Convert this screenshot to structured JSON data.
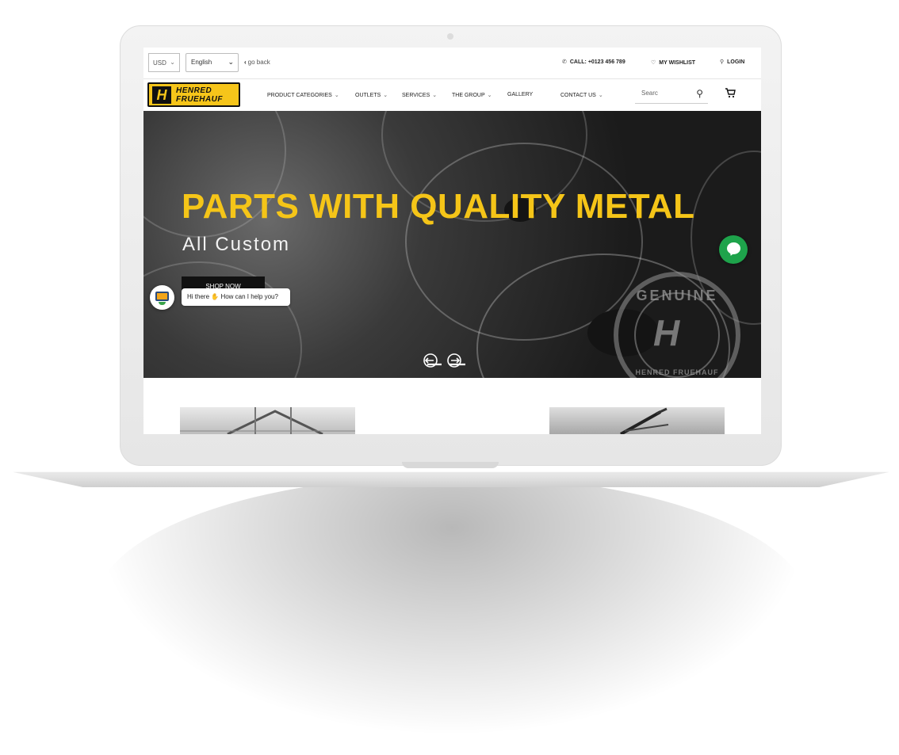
{
  "topbar": {
    "currency": "USD",
    "language": "English",
    "go_back": "go back",
    "call": "CALL: +0123 456 789",
    "wishlist": "MY WISHLIST",
    "login": "LOGIN"
  },
  "logo": {
    "line1": "HENRED",
    "line2": "FRUEHAUF"
  },
  "nav": {
    "items": [
      {
        "label": "PRODUCT CATEGORIES"
      },
      {
        "label": "OUTLETS"
      },
      {
        "label": "SERVICES"
      },
      {
        "label": "THE GROUP"
      },
      {
        "label": "GALLERY"
      },
      {
        "label": "CONTACT US"
      }
    ],
    "search_placeholder": "Searc"
  },
  "hero": {
    "title": "PARTS WITH QUALITY METAL",
    "subtitle": "All Custom",
    "cta": "SHOP NOW",
    "stamp_top": "GENUINE",
    "stamp_bottom": "HENRED FRUEHAUF"
  },
  "chat": {
    "greeting_prefix": "Hi there",
    "greeting_suffix": "How can I help you?"
  },
  "colors": {
    "accent": "#f5c518",
    "chat_green": "#1ea34b",
    "logo_yellow": "#f6c51a"
  }
}
